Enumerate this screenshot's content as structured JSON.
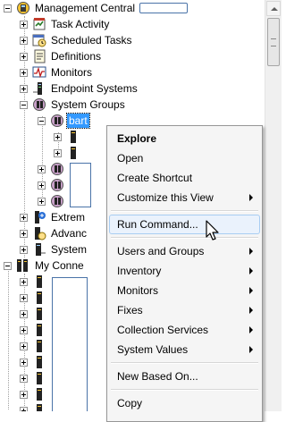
{
  "tree": {
    "root_label": "Management Central",
    "items": [
      {
        "label": "Task Activity",
        "icon": "task-activity-icon"
      },
      {
        "label": "Scheduled Tasks",
        "icon": "scheduled-tasks-icon"
      },
      {
        "label": "Definitions",
        "icon": "definitions-icon"
      },
      {
        "label": "Monitors",
        "icon": "monitors-icon"
      },
      {
        "label": "Endpoint Systems",
        "icon": "endpoint-systems-icon"
      },
      {
        "label": "System Groups",
        "icon": "system-groups-icon"
      }
    ],
    "selected_group": "bart",
    "partial_items": [
      "Extrem",
      "Advanc",
      "System"
    ],
    "my_connections_label": "My Conne"
  },
  "context_menu": {
    "items": [
      {
        "label": "Explore",
        "bold": true,
        "submenu": false
      },
      {
        "label": "Open",
        "submenu": false
      },
      {
        "label": "Create Shortcut",
        "submenu": false
      },
      {
        "label": "Customize this View",
        "submenu": true
      },
      {
        "label": "Run Command...",
        "submenu": false,
        "highlighted": true
      },
      {
        "label": "Users and Groups",
        "submenu": true
      },
      {
        "label": "Inventory",
        "submenu": true
      },
      {
        "label": "Monitors",
        "submenu": true
      },
      {
        "label": "Fixes",
        "submenu": true
      },
      {
        "label": "Collection Services",
        "submenu": true
      },
      {
        "label": "System Values",
        "submenu": true
      },
      {
        "label": "New Based On...",
        "submenu": false
      },
      {
        "label": "Copy",
        "submenu": false
      }
    ]
  },
  "colors": {
    "selection": "#3399ff",
    "menu_background": "#f5f5f5",
    "menu_hover": "#eaf2fc"
  }
}
